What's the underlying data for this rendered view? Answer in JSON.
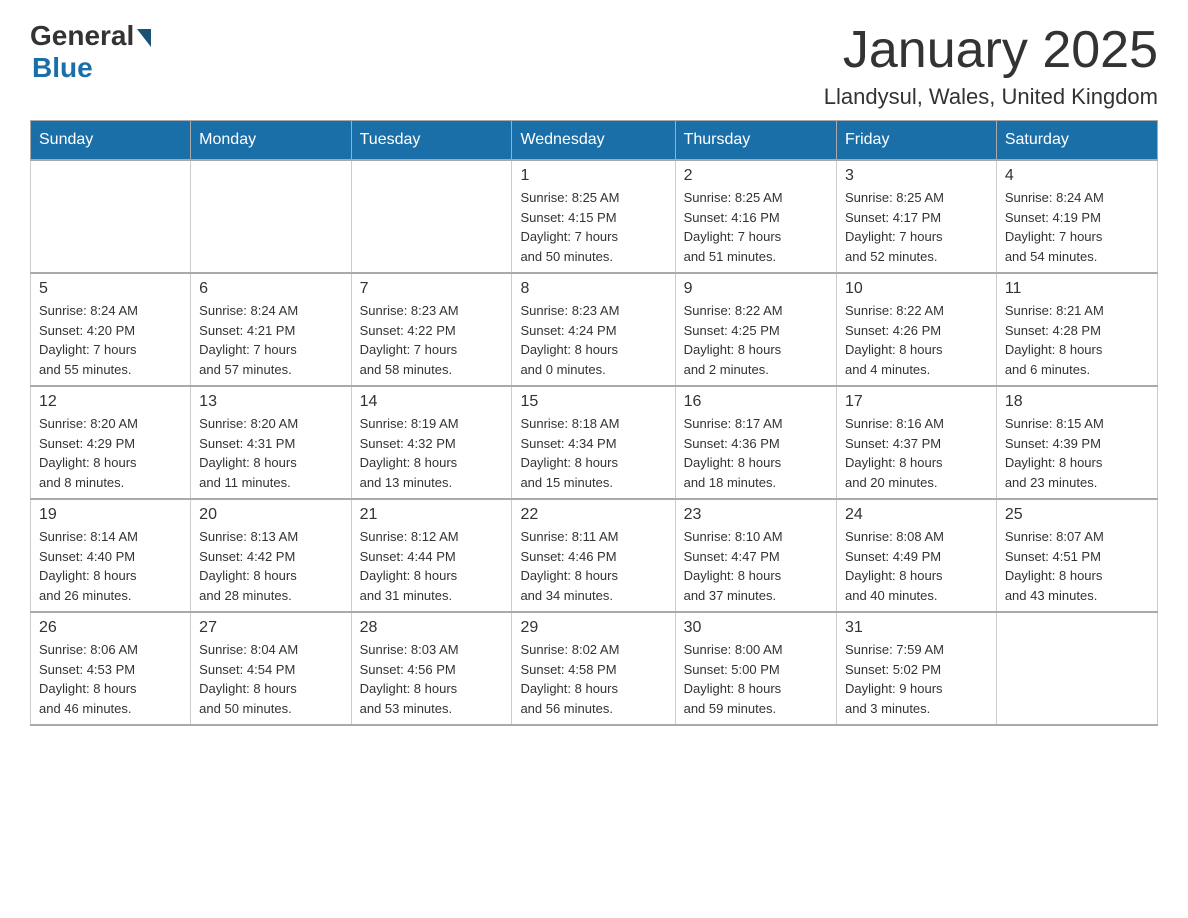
{
  "header": {
    "logo_general": "General",
    "logo_blue": "Blue",
    "title": "January 2025",
    "location": "Llandysul, Wales, United Kingdom"
  },
  "weekdays": [
    "Sunday",
    "Monday",
    "Tuesday",
    "Wednesday",
    "Thursday",
    "Friday",
    "Saturday"
  ],
  "weeks": [
    [
      {
        "day": "",
        "info": ""
      },
      {
        "day": "",
        "info": ""
      },
      {
        "day": "",
        "info": ""
      },
      {
        "day": "1",
        "info": "Sunrise: 8:25 AM\nSunset: 4:15 PM\nDaylight: 7 hours\nand 50 minutes."
      },
      {
        "day": "2",
        "info": "Sunrise: 8:25 AM\nSunset: 4:16 PM\nDaylight: 7 hours\nand 51 minutes."
      },
      {
        "day": "3",
        "info": "Sunrise: 8:25 AM\nSunset: 4:17 PM\nDaylight: 7 hours\nand 52 minutes."
      },
      {
        "day": "4",
        "info": "Sunrise: 8:24 AM\nSunset: 4:19 PM\nDaylight: 7 hours\nand 54 minutes."
      }
    ],
    [
      {
        "day": "5",
        "info": "Sunrise: 8:24 AM\nSunset: 4:20 PM\nDaylight: 7 hours\nand 55 minutes."
      },
      {
        "day": "6",
        "info": "Sunrise: 8:24 AM\nSunset: 4:21 PM\nDaylight: 7 hours\nand 57 minutes."
      },
      {
        "day": "7",
        "info": "Sunrise: 8:23 AM\nSunset: 4:22 PM\nDaylight: 7 hours\nand 58 minutes."
      },
      {
        "day": "8",
        "info": "Sunrise: 8:23 AM\nSunset: 4:24 PM\nDaylight: 8 hours\nand 0 minutes."
      },
      {
        "day": "9",
        "info": "Sunrise: 8:22 AM\nSunset: 4:25 PM\nDaylight: 8 hours\nand 2 minutes."
      },
      {
        "day": "10",
        "info": "Sunrise: 8:22 AM\nSunset: 4:26 PM\nDaylight: 8 hours\nand 4 minutes."
      },
      {
        "day": "11",
        "info": "Sunrise: 8:21 AM\nSunset: 4:28 PM\nDaylight: 8 hours\nand 6 minutes."
      }
    ],
    [
      {
        "day": "12",
        "info": "Sunrise: 8:20 AM\nSunset: 4:29 PM\nDaylight: 8 hours\nand 8 minutes."
      },
      {
        "day": "13",
        "info": "Sunrise: 8:20 AM\nSunset: 4:31 PM\nDaylight: 8 hours\nand 11 minutes."
      },
      {
        "day": "14",
        "info": "Sunrise: 8:19 AM\nSunset: 4:32 PM\nDaylight: 8 hours\nand 13 minutes."
      },
      {
        "day": "15",
        "info": "Sunrise: 8:18 AM\nSunset: 4:34 PM\nDaylight: 8 hours\nand 15 minutes."
      },
      {
        "day": "16",
        "info": "Sunrise: 8:17 AM\nSunset: 4:36 PM\nDaylight: 8 hours\nand 18 minutes."
      },
      {
        "day": "17",
        "info": "Sunrise: 8:16 AM\nSunset: 4:37 PM\nDaylight: 8 hours\nand 20 minutes."
      },
      {
        "day": "18",
        "info": "Sunrise: 8:15 AM\nSunset: 4:39 PM\nDaylight: 8 hours\nand 23 minutes."
      }
    ],
    [
      {
        "day": "19",
        "info": "Sunrise: 8:14 AM\nSunset: 4:40 PM\nDaylight: 8 hours\nand 26 minutes."
      },
      {
        "day": "20",
        "info": "Sunrise: 8:13 AM\nSunset: 4:42 PM\nDaylight: 8 hours\nand 28 minutes."
      },
      {
        "day": "21",
        "info": "Sunrise: 8:12 AM\nSunset: 4:44 PM\nDaylight: 8 hours\nand 31 minutes."
      },
      {
        "day": "22",
        "info": "Sunrise: 8:11 AM\nSunset: 4:46 PM\nDaylight: 8 hours\nand 34 minutes."
      },
      {
        "day": "23",
        "info": "Sunrise: 8:10 AM\nSunset: 4:47 PM\nDaylight: 8 hours\nand 37 minutes."
      },
      {
        "day": "24",
        "info": "Sunrise: 8:08 AM\nSunset: 4:49 PM\nDaylight: 8 hours\nand 40 minutes."
      },
      {
        "day": "25",
        "info": "Sunrise: 8:07 AM\nSunset: 4:51 PM\nDaylight: 8 hours\nand 43 minutes."
      }
    ],
    [
      {
        "day": "26",
        "info": "Sunrise: 8:06 AM\nSunset: 4:53 PM\nDaylight: 8 hours\nand 46 minutes."
      },
      {
        "day": "27",
        "info": "Sunrise: 8:04 AM\nSunset: 4:54 PM\nDaylight: 8 hours\nand 50 minutes."
      },
      {
        "day": "28",
        "info": "Sunrise: 8:03 AM\nSunset: 4:56 PM\nDaylight: 8 hours\nand 53 minutes."
      },
      {
        "day": "29",
        "info": "Sunrise: 8:02 AM\nSunset: 4:58 PM\nDaylight: 8 hours\nand 56 minutes."
      },
      {
        "day": "30",
        "info": "Sunrise: 8:00 AM\nSunset: 5:00 PM\nDaylight: 8 hours\nand 59 minutes."
      },
      {
        "day": "31",
        "info": "Sunrise: 7:59 AM\nSunset: 5:02 PM\nDaylight: 9 hours\nand 3 minutes."
      },
      {
        "day": "",
        "info": ""
      }
    ]
  ]
}
